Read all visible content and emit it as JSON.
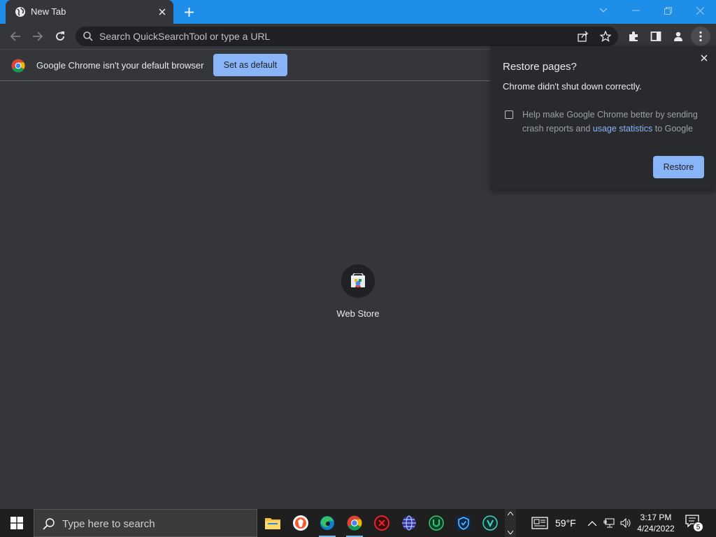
{
  "browser": {
    "tab_title": "New Tab",
    "omnibox_placeholder": "Search QuickSearchTool or type a URL"
  },
  "infobar": {
    "message": "Google Chrome isn't your default browser",
    "set_default_label": "Set as default"
  },
  "restore_popup": {
    "title": "Restore pages?",
    "message": "Chrome didn't shut down correctly.",
    "checkbox_text_before": "Help make Google Chrome better by sending crash reports and",
    "checkbox_link": "usage statistics",
    "checkbox_text_after": "to Google",
    "checkbox_checked": false,
    "restore_label": "Restore"
  },
  "new_tab_page": {
    "shortcuts": [
      {
        "label": "Web Store",
        "icon": "web-store-icon"
      }
    ]
  },
  "taskbar": {
    "search_placeholder": "Type here to search",
    "weather": "59°F",
    "time": "3:17 PM",
    "date": "4/24/2022",
    "notification_count": "5",
    "apps": [
      "file-explorer-icon",
      "brave-icon",
      "edge-icon",
      "chrome-icon",
      "app-red-icon",
      "app-globe-icon",
      "app-u-icon",
      "app-shield-icon",
      "app-v-icon"
    ]
  },
  "colors": {
    "titlebar": "#1f8ee8",
    "toolbar": "#35363a",
    "accent": "#8ab4f8",
    "taskbar": "#1f1f1f"
  }
}
